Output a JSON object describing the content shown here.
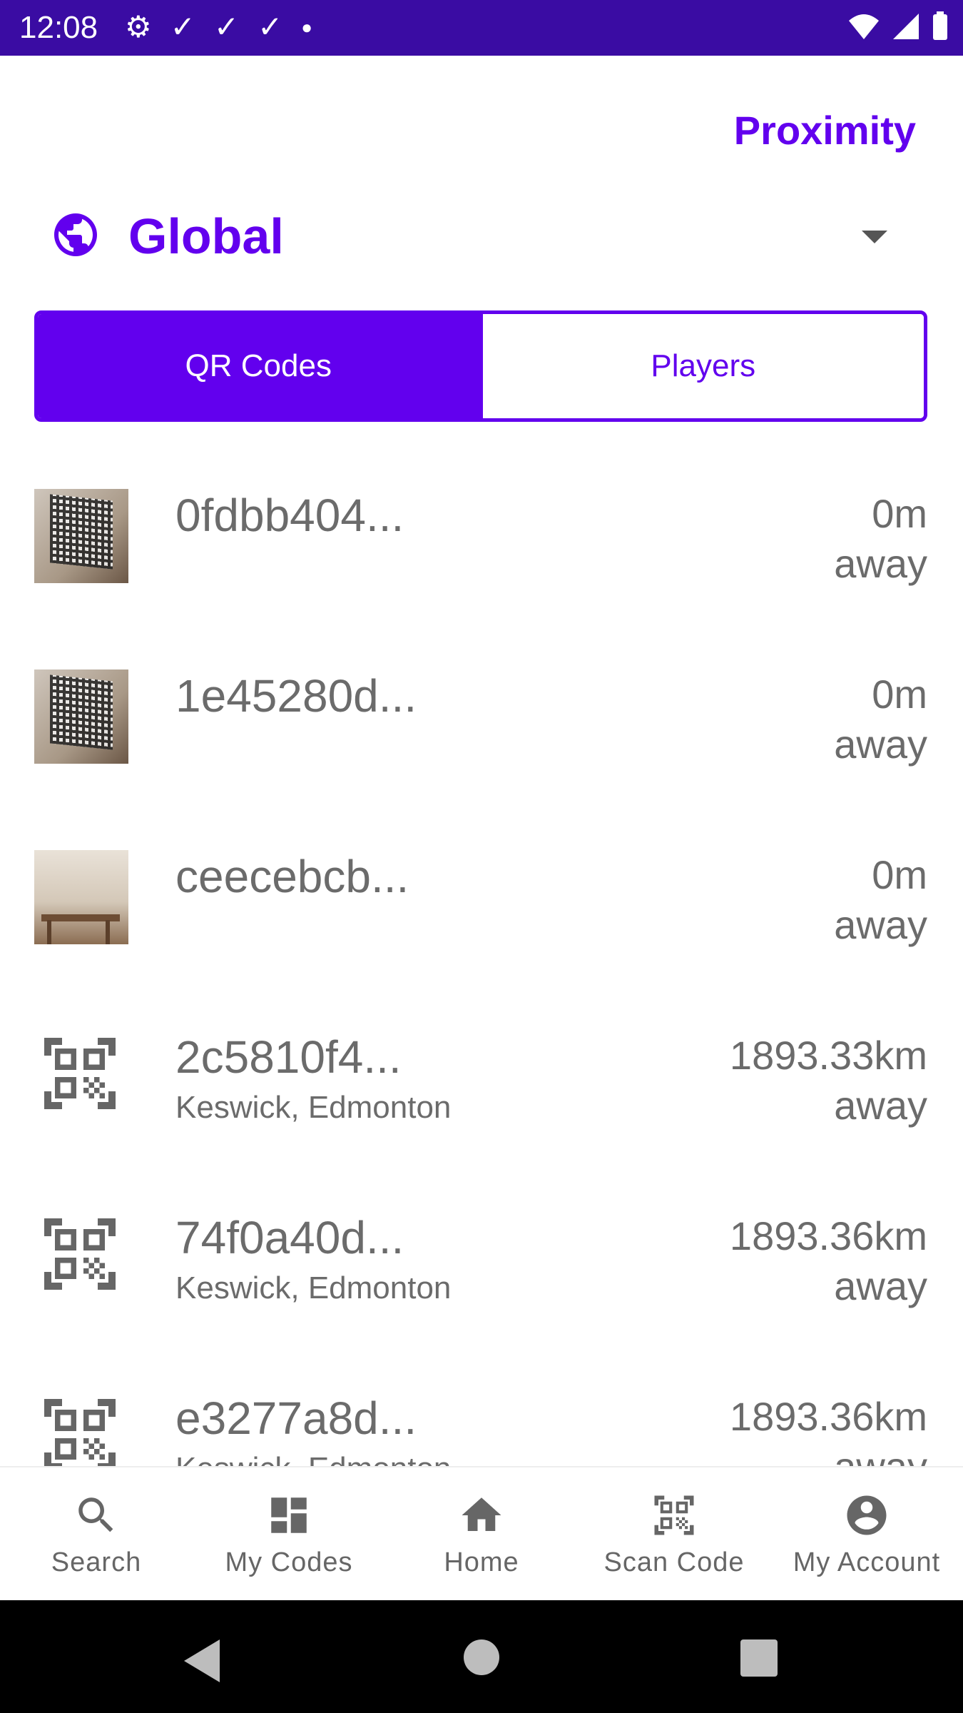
{
  "status_bar": {
    "time": "12:08"
  },
  "header": {
    "proximity_label": "Proximity",
    "scope_label": "Global"
  },
  "toggle": {
    "qr_codes_label": "QR Codes",
    "players_label": "Players"
  },
  "codes": [
    {
      "name": "0fdbb404...",
      "location": "",
      "distance": "0m",
      "away": "away",
      "thumb": "photo-qr"
    },
    {
      "name": "1e45280d...",
      "location": "",
      "distance": "0m",
      "away": "away",
      "thumb": "photo-qr"
    },
    {
      "name": "ceecebcb...",
      "location": "",
      "distance": "0m",
      "away": "away",
      "thumb": "photo-room"
    },
    {
      "name": "2c5810f4...",
      "location": "Keswick, Edmonton",
      "distance": "1893.33km",
      "away": "away",
      "thumb": "qr-icon"
    },
    {
      "name": "74f0a40d...",
      "location": "Keswick, Edmonton",
      "distance": "1893.36km",
      "away": "away",
      "thumb": "qr-icon"
    },
    {
      "name": "e3277a8d...",
      "location": "Keswick, Edmonton",
      "distance": "1893.36km",
      "away": "away",
      "thumb": "qr-icon"
    }
  ],
  "bottom_nav": {
    "search": "Search",
    "my_codes": "My Codes",
    "home": "Home",
    "scan_code": "Scan Code",
    "my_account": "My Account"
  },
  "colors": {
    "accent": "#6200ee",
    "status_bar": "#3a0ca3"
  }
}
